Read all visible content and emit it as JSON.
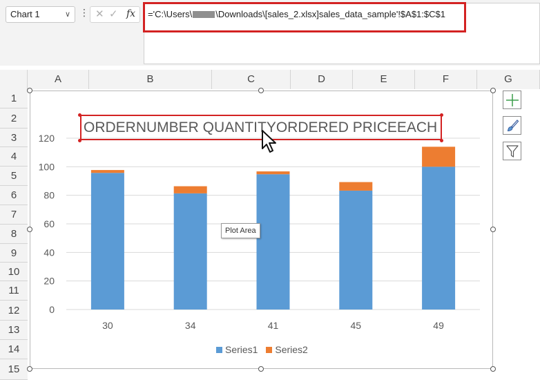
{
  "name_box": {
    "value": "Chart 1"
  },
  "formula_bar": {
    "prefix": "='C:\\Users\\",
    "suffix": "\\Downloads\\[sales_2.xlsx]sales_data_sample'!$A$1:$C$1"
  },
  "columns": [
    "A",
    "B",
    "C",
    "D",
    "E",
    "F",
    "G"
  ],
  "rows": [
    "1",
    "2",
    "3",
    "4",
    "5",
    "6",
    "7",
    "8",
    "9",
    "10",
    "11",
    "12",
    "13",
    "14",
    "15"
  ],
  "tooltip": "Plot Area",
  "colors": {
    "series1": "#5b9bd5",
    "series2": "#ed7d31",
    "highlight": "#d32222",
    "plus_icon": "#3c9e4b"
  },
  "side_buttons": [
    "chart-elements-plus-icon",
    "chart-styles-brush-icon",
    "chart-filters-funnel-icon"
  ],
  "chart_data": {
    "type": "bar",
    "stacked": true,
    "title": "ORDERNUMBER QUANTITYORDERED PRICEEACH",
    "categories": [
      "30",
      "34",
      "41",
      "45",
      "49"
    ],
    "series": [
      {
        "name": "Series1",
        "values": [
          95.7,
          81.35,
          94.74,
          83.26,
          100
        ]
      },
      {
        "name": "Series2",
        "values": [
          2,
          5,
          2,
          6,
          14
        ]
      }
    ],
    "ylim": [
      0,
      120
    ],
    "yticks": [
      "0",
      "20",
      "40",
      "60",
      "80",
      "100",
      "120"
    ],
    "grid": true,
    "legend": "bottom",
    "xlabel": "",
    "ylabel": ""
  }
}
